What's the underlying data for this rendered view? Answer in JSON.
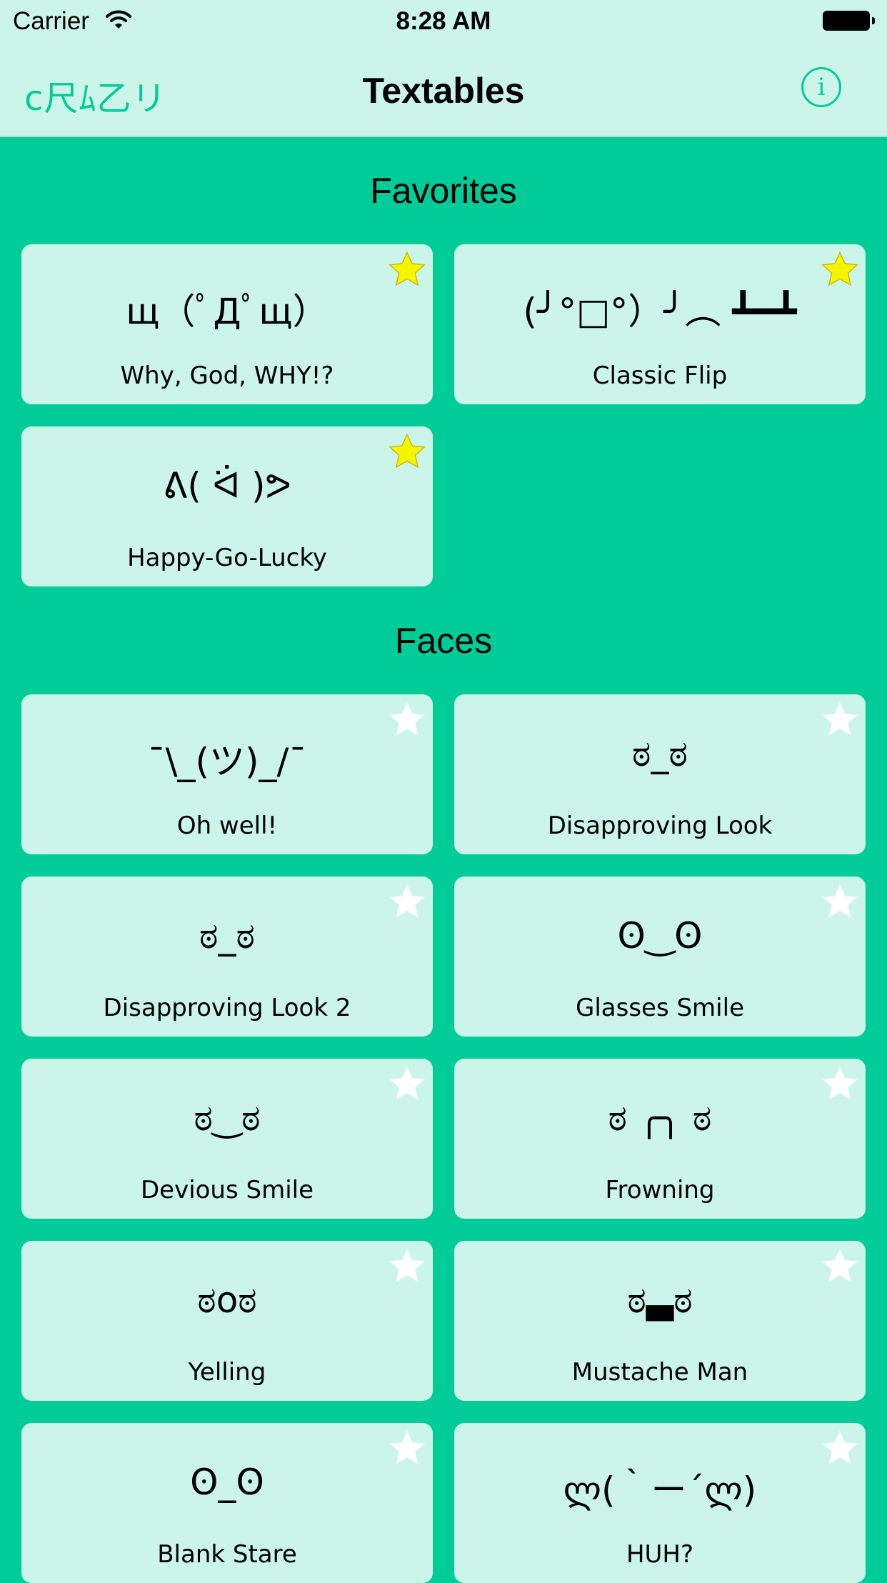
{
  "status_bar": {
    "carrier": "Carrier",
    "time": "8:28 AM"
  },
  "nav": {
    "brand": "c尺ﾑ乙リ",
    "title": "Textables",
    "info_glyph": "i"
  },
  "colors": {
    "background": "#00cc99",
    "card": "#ccf5ea",
    "favorite_star": "#f5f500",
    "unfavorite_star": "#ffffff"
  },
  "sections": [
    {
      "title": "Favorites",
      "items": [
        {
          "face": "щ（ﾟДﾟщ）",
          "label": "Why, God, WHY!?",
          "favorite": true
        },
        {
          "face": "(╯°□°）╯︵ ┻━┻",
          "label": "Classic Flip",
          "favorite": true
        },
        {
          "face": "ᕕ( ᐛ )ᕗ",
          "label": "Happy-Go-Lucky",
          "favorite": true
        }
      ]
    },
    {
      "title": "Faces",
      "items": [
        {
          "face": "¯\\_(ツ)_/¯",
          "label": "Oh well!",
          "favorite": false
        },
        {
          "face": "ಠ_ಠ",
          "label": "Disapproving Look",
          "favorite": false
        },
        {
          "face": "ಠ_ಠ",
          "label": "Disapproving Look 2",
          "favorite": false
        },
        {
          "face": "ʘ‿ʘ",
          "label": "Glasses Smile",
          "favorite": false
        },
        {
          "face": "ಠ‿ಠ",
          "label": "Devious Smile",
          "favorite": false
        },
        {
          "face": "ಠ ╭╮ ಠ",
          "label": "Frowning",
          "favorite": false
        },
        {
          "face": "ಠoಠ",
          "label": "Yelling",
          "favorite": false
        },
        {
          "face": "ಠ▃ಠ",
          "label": "Mustache Man",
          "favorite": false
        },
        {
          "face": "ʘ_ʘ",
          "label": "Blank Stare",
          "favorite": false
        },
        {
          "face": "ლ(｀ー´ლ)",
          "label": "HUH?",
          "favorite": false
        }
      ]
    }
  ]
}
